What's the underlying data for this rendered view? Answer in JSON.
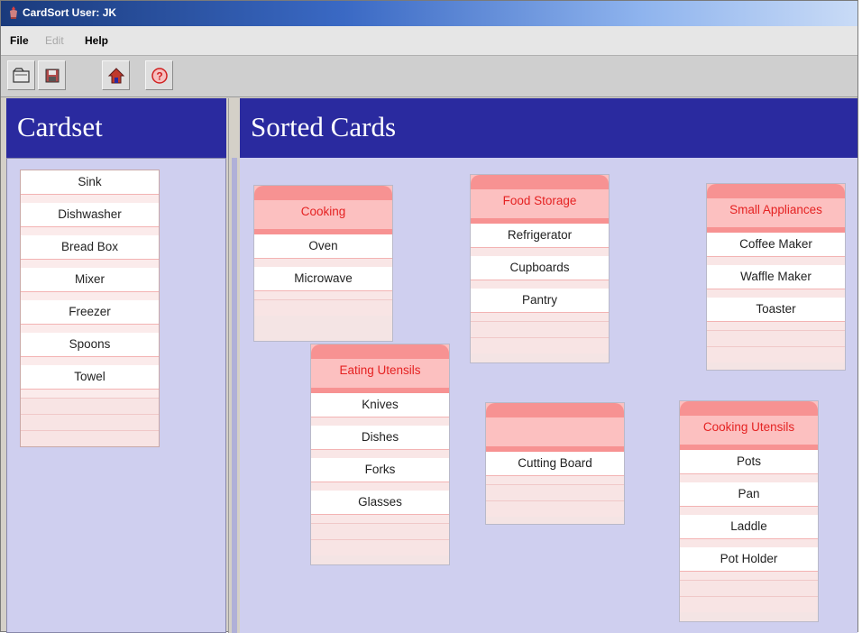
{
  "window": {
    "title": "CardSort User: JK"
  },
  "menu": [
    {
      "label": "File",
      "enabled": true
    },
    {
      "label": "Edit",
      "enabled": false
    },
    {
      "label": "Help",
      "enabled": true
    }
  ],
  "toolbar": {
    "buttons": [
      {
        "icon": "open-folder-icon"
      },
      {
        "icon": "save-disk-icon"
      },
      {
        "icon": "home-icon"
      },
      {
        "icon": "help-icon"
      }
    ]
  },
  "cardset": {
    "title": "Cardset",
    "cards": [
      "Sink",
      "Dishwasher",
      "Bread Box",
      "Mixer",
      "Freezer",
      "Spoons",
      "Towel"
    ]
  },
  "sorted": {
    "title": "Sorted Cards",
    "groups": [
      {
        "name": "Cooking",
        "cards": [
          "Oven",
          "Microwave"
        ]
      },
      {
        "name": "Food Storage",
        "cards": [
          "Refrigerator",
          "Cupboards",
          "Pantry"
        ]
      },
      {
        "name": "Small Appliances",
        "cards": [
          "Coffee Maker",
          "Waffle Maker",
          "Toaster"
        ]
      },
      {
        "name": "Eating Utensils",
        "cards": [
          "Knives",
          "Dishes",
          "Forks",
          "Glasses"
        ]
      },
      {
        "name": "",
        "cards": [
          "Cutting Board"
        ]
      },
      {
        "name": "Cooking Utensils",
        "cards": [
          "Pots",
          "Pan",
          "Laddle",
          "Pot Holder"
        ]
      }
    ]
  },
  "colors": {
    "header_bg": "#2a2a9f",
    "panel_bg": "#cfcfef",
    "group_tab": "#f79292",
    "group_header": "#fcc0c0",
    "group_title_text": "#e52222"
  }
}
